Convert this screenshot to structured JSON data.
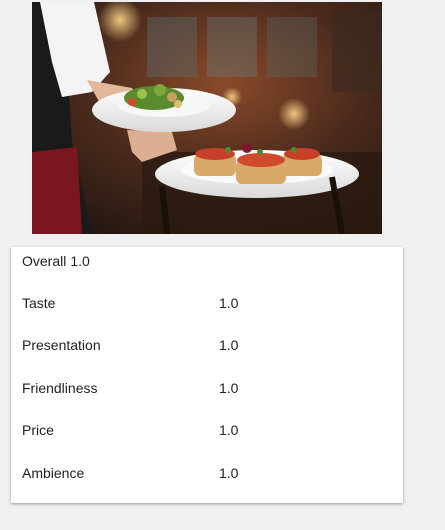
{
  "image": {
    "alt_semantic": "waiter-serving-food-photo"
  },
  "rating_card": {
    "overall_label": "Overall",
    "overall_value": "1.0",
    "criteria": [
      {
        "label": "Taste",
        "value": "1.0"
      },
      {
        "label": "Presentation",
        "value": "1.0"
      },
      {
        "label": "Friendliness",
        "value": "1.0"
      },
      {
        "label": "Price",
        "value": "1.0"
      },
      {
        "label": "Ambience",
        "value": "1.0"
      }
    ]
  },
  "colors": {
    "page_background": "#f0f0f0",
    "card_background": "#ffffff",
    "text": "#222222"
  }
}
